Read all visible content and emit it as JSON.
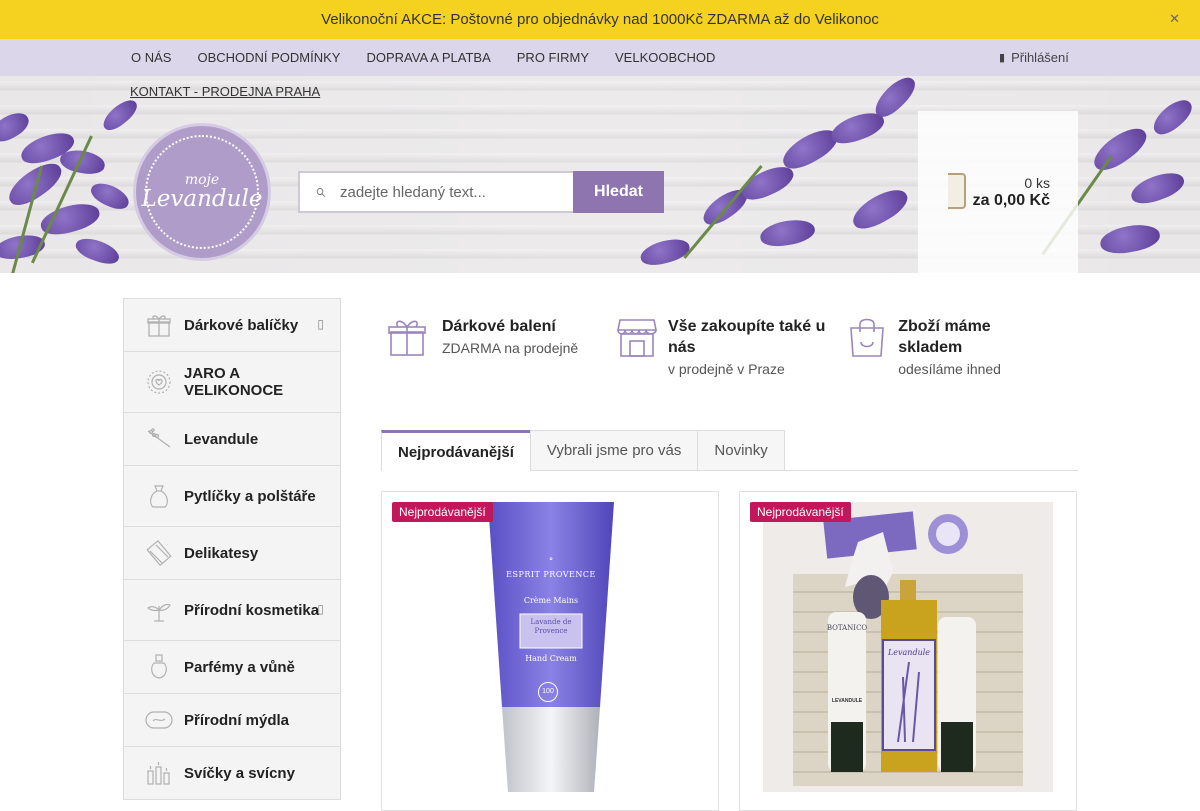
{
  "promo": {
    "text": "Velikonoční AKCE: Poštovné pro objednávky nad 1000Kč ZDARMA až do Velikonoc",
    "close_icon": "close-icon"
  },
  "nav": {
    "items": [
      "O NÁS",
      "OBCHODNÍ PODMÍNKY",
      "DOPRAVA A PLATBA",
      "PRO FIRMY",
      "VELKOOBCHOD"
    ],
    "second_row": "KONTAKT - PRODEJNA PRAHA",
    "login": "Přihlášení"
  },
  "logo": {
    "small": "moje",
    "big": "Levandule"
  },
  "search": {
    "placeholder": "zadejte hledaný text...",
    "button": "Hledat"
  },
  "cart": {
    "count": "0 ks",
    "total": "za 0,00 Kč"
  },
  "categories": [
    {
      "label": "Dárkové balíčky",
      "icon": "gift-icon",
      "has_sub": true
    },
    {
      "label": "JARO A VELIKONOCE",
      "icon": "wreath-icon",
      "has_sub": false
    },
    {
      "label": "Levandule",
      "icon": "lavender-sprig-icon",
      "has_sub": false
    },
    {
      "label": "Pytlíčky a polštáře",
      "icon": "sachet-icon",
      "has_sub": false
    },
    {
      "label": "Delikatesy",
      "icon": "chocolate-icon",
      "has_sub": false
    },
    {
      "label": "Přírodní kosmetika",
      "icon": "leaf-icon",
      "has_sub": true
    },
    {
      "label": "Parfémy a vůně",
      "icon": "perfume-icon",
      "has_sub": false
    },
    {
      "label": "Přírodní mýdla",
      "icon": "soap-icon",
      "has_sub": false
    },
    {
      "label": "Svíčky a svícny",
      "icon": "candles-icon",
      "has_sub": false
    }
  ],
  "benefits": [
    {
      "title": "Dárkové balení",
      "sub": "ZDARMA na prodejně",
      "icon": "gift-icon"
    },
    {
      "title": "Vše zakoupíte také u nás",
      "sub": "v prodejně v Praze",
      "icon": "store-icon"
    },
    {
      "title": "Zboží máme skladem",
      "sub": "odesíláme ihned",
      "icon": "shopping-bag-icon"
    }
  ],
  "tabs": [
    "Nejprodávanější",
    "Vybrali jsme pro vás",
    "Novinky"
  ],
  "products": [
    {
      "badge": "Nejprodávanější",
      "brand": "ESPRIT PROVENCE",
      "line1": "Crème Mains",
      "line2": "Lavande de Provence",
      "line3": "Hand Cream",
      "volume": "100"
    },
    {
      "badge": "Nejprodávanější",
      "label1": "BOTANICO",
      "label2": "Levandule",
      "label3": "LEVANDULE"
    }
  ]
}
